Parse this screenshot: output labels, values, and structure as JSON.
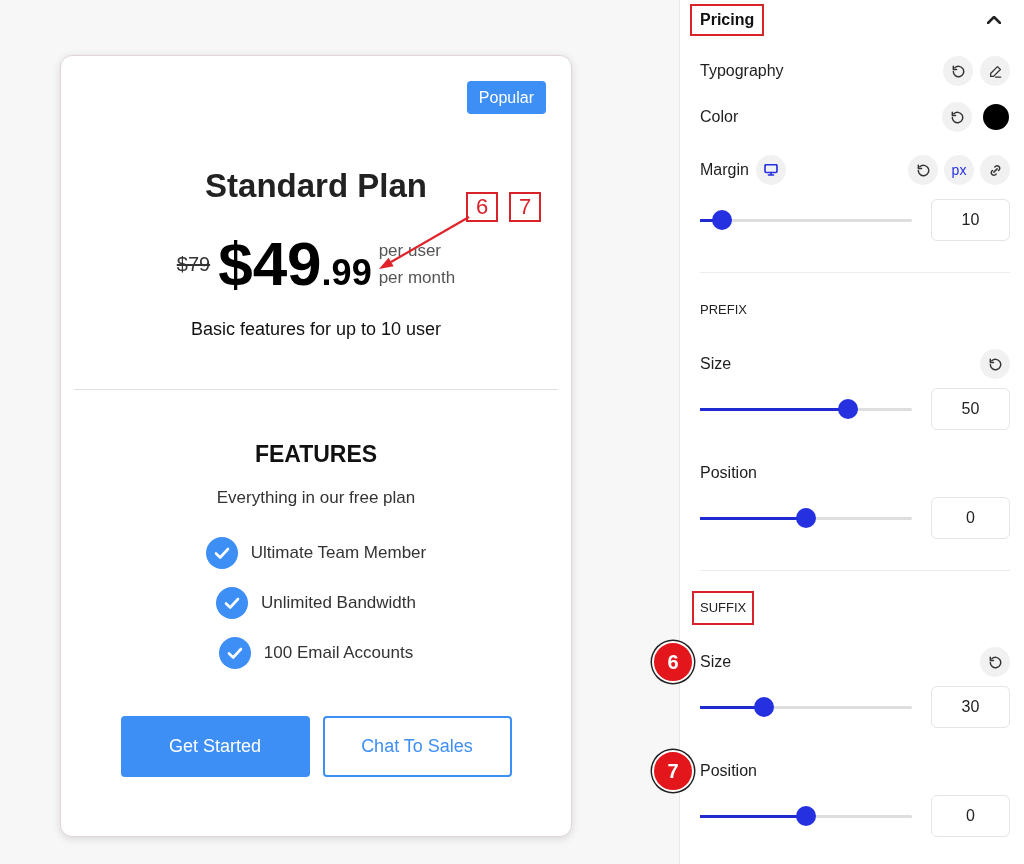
{
  "pricing_card": {
    "badge": "Popular",
    "title": "Standard Plan",
    "price": {
      "original": "$79",
      "amount": "$49",
      "cents": ".99",
      "period": [
        "per user",
        "per month"
      ]
    },
    "description": "Basic features for up to 10 user",
    "features_heading": "FEATURES",
    "features_subtitle": "Everything in our free plan",
    "features": [
      "Ultimate Team Member",
      "Unlimited Bandwidth",
      "100 Email Accounts"
    ],
    "buttons": [
      {
        "label": "Get Started",
        "kind": "primary"
      },
      {
        "label": "Chat To Sales",
        "kind": "outline"
      }
    ],
    "callouts": [
      "6",
      "7"
    ]
  },
  "settings_panel": {
    "header": {
      "title": "Pricing",
      "expanded": true,
      "highlighted": true
    },
    "controls": [
      {
        "kind": "typography",
        "label": "Typography"
      },
      {
        "kind": "color",
        "label": "Color",
        "color": "#000000"
      },
      {
        "kind": "spacing",
        "label": "Margin",
        "unit": "px",
        "value": "10",
        "level": 0.06
      }
    ],
    "sections": [
      {
        "title": "PREFIX",
        "highlighted": false,
        "sliders": [
          {
            "label": "Size",
            "resettable": true,
            "value": "50",
            "level": 0.72
          },
          {
            "label": "Position",
            "resettable": false,
            "value": "0",
            "level": 0.5
          }
        ]
      },
      {
        "title": "SUFFIX",
        "highlighted": true,
        "sliders": [
          {
            "label": "Size",
            "marker": "6",
            "resettable": true,
            "value": "30",
            "level": 0.28
          },
          {
            "label": "Position",
            "marker": "7",
            "resettable": false,
            "value": "0",
            "level": 0.5
          }
        ]
      }
    ]
  }
}
